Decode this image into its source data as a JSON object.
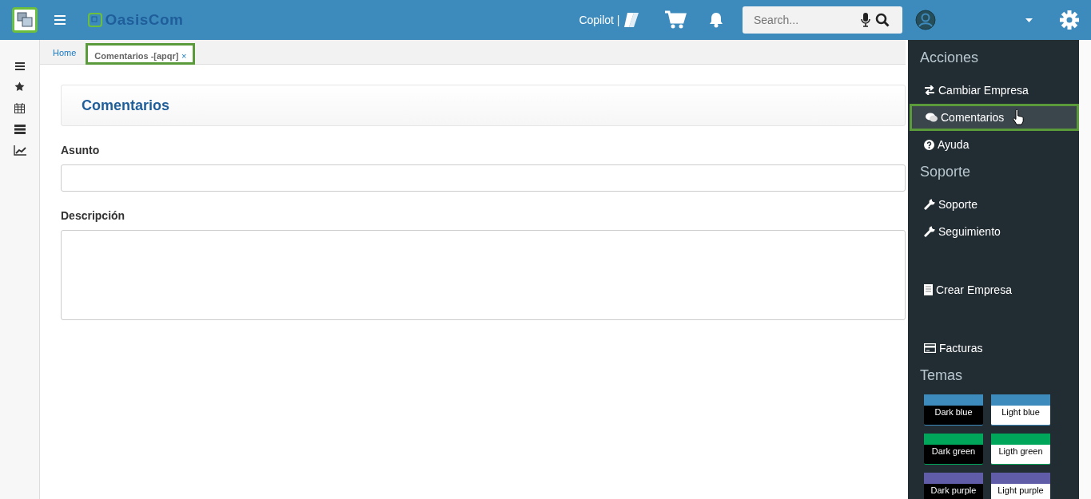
{
  "topbar": {
    "logo_text": "OasisCom",
    "copilot": "Copilot |",
    "search": {
      "placeholder": "Search..."
    }
  },
  "tabs": [
    {
      "label": "Home",
      "selected": false,
      "closable": false
    },
    {
      "label": "Comentarios -[apqr]",
      "selected": true,
      "closable": true,
      "close": "×"
    }
  ],
  "page": {
    "title": "Comentarios",
    "fields": [
      {
        "label": "Asunto",
        "kind": "input"
      },
      {
        "label": "Descripción",
        "kind": "textarea"
      }
    ]
  },
  "menu": {
    "sections": [
      {
        "title": "Acciones",
        "items": [
          {
            "label": "Cambiar Empresa",
            "selected": false
          },
          {
            "label": "Comentarios",
            "selected": true
          },
          {
            "label": "Ayuda",
            "selected": false
          }
        ]
      },
      {
        "title": "Soporte",
        "items": [
          {
            "label": "Soporte",
            "selected": false
          },
          {
            "label": "Seguimiento",
            "selected": false
          },
          {
            "label": "Crear Empresa",
            "selected": false
          },
          {
            "label": "Facturas",
            "selected": false
          }
        ]
      }
    ],
    "themes_title": "Temas",
    "themes": [
      {
        "label": "Dark blue",
        "kind": "dark",
        "color": "#3d8bbd"
      },
      {
        "label": "Light blue",
        "kind": "light",
        "color": "#3d8bbd"
      },
      {
        "label": "Dark green",
        "kind": "dark",
        "color": "#00a65a"
      },
      {
        "label": "Ligth green",
        "kind": "light",
        "color": "#00a65a"
      },
      {
        "label": "Dark purple",
        "kind": "dark",
        "color": "#605ca8"
      },
      {
        "label": "Light purple",
        "kind": "light",
        "color": "#605ca8"
      }
    ]
  }
}
